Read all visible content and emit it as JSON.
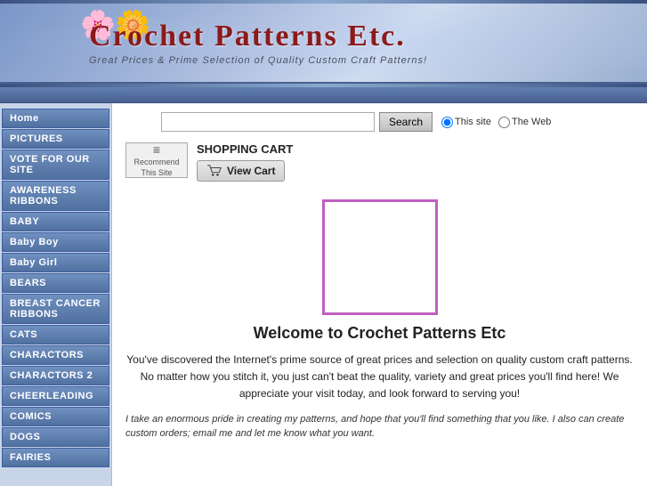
{
  "header": {
    "title": "Crochet Patterns Etc.",
    "subtitle": "Great Prices & Prime Selection of Quality Custom Craft Patterns!",
    "flowers_emoji": "🌸🌼"
  },
  "search": {
    "placeholder": "",
    "button_label": "Search",
    "option_this_site": "This site",
    "option_web": "The Web"
  },
  "recommend": {
    "icon": "≡",
    "line1": "Recommend",
    "line2": "This Site"
  },
  "shopping_cart": {
    "label": "SHOPPING CART",
    "view_cart_label": "View Cart"
  },
  "sidebar": {
    "items": [
      {
        "label": "Home"
      },
      {
        "label": "PICTURES"
      },
      {
        "label": "VOTE FOR OUR SITE"
      },
      {
        "label": "AWARENESS RIBBONS"
      },
      {
        "label": "BABY"
      },
      {
        "label": "Baby Boy"
      },
      {
        "label": "Baby Girl"
      },
      {
        "label": "BEARS"
      },
      {
        "label": "BREAST CANCER RIBBONS"
      },
      {
        "label": "CATS"
      },
      {
        "label": "CHARACTORS"
      },
      {
        "label": "CHARACTORS 2"
      },
      {
        "label": "CHEERLEADING"
      },
      {
        "label": "COMICS"
      },
      {
        "label": "DOGS"
      },
      {
        "label": "FAIRIES"
      }
    ]
  },
  "welcome": {
    "title": "Welcome to Crochet Patterns Etc",
    "text1": "You've discovered the Internet's prime source of great prices and selection on quality custom craft patterns.  No matter how you stitch it, you just can't beat the quality, variety and great prices you'll find here! We appreciate your visit today, and look forward to serving you!",
    "text2": "I take an enormous pride in creating my patterns, and hope that you'll find something that you like.  I also can create custom orders; email me and let me know what you want."
  },
  "colors": {
    "accent": "#8B1A1A",
    "nav_bg": "#5070a0",
    "border_purple": "#c060c0"
  }
}
